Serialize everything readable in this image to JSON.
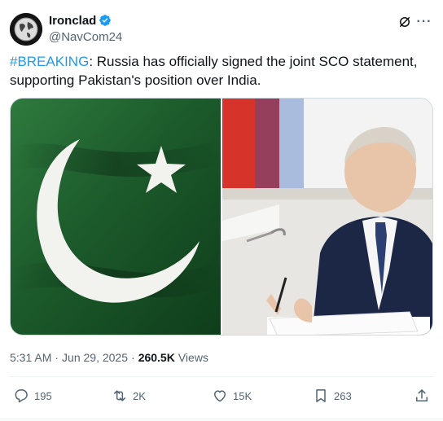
{
  "author": {
    "display_name": "Ironclad",
    "handle": "@NavCom24",
    "verified": true,
    "avatar_icon": "globe-avatar"
  },
  "header_icons": {
    "grok": "grok-icon",
    "more": "more-icon",
    "more_glyph": "···"
  },
  "post": {
    "hashtag": "#BREAKING",
    "text": ": Russia has officially signed the joint SCO statement, supporting Pakistan's position over India."
  },
  "media": {
    "left_image": "pakistan-flag-image",
    "right_image": "man-signing-document-image",
    "colors": {
      "flag_green": "#1f5c2e",
      "flag_white": "#f4f4f0",
      "russian_white": "#f3f3f3",
      "russian_blue": "#1f56b8",
      "russian_red": "#d6342b",
      "suit": "#1c2645"
    }
  },
  "meta": {
    "time": "5:31 AM",
    "date": "Jun 29, 2025",
    "views_count": "260.5K",
    "views_label": "Views"
  },
  "actions": {
    "replies": "195",
    "reposts": "2K",
    "likes": "15K",
    "bookmarks": "263"
  },
  "colors": {
    "accent": "#1d9bf0",
    "text_primary": "#0f1419",
    "text_secondary": "#536471"
  }
}
